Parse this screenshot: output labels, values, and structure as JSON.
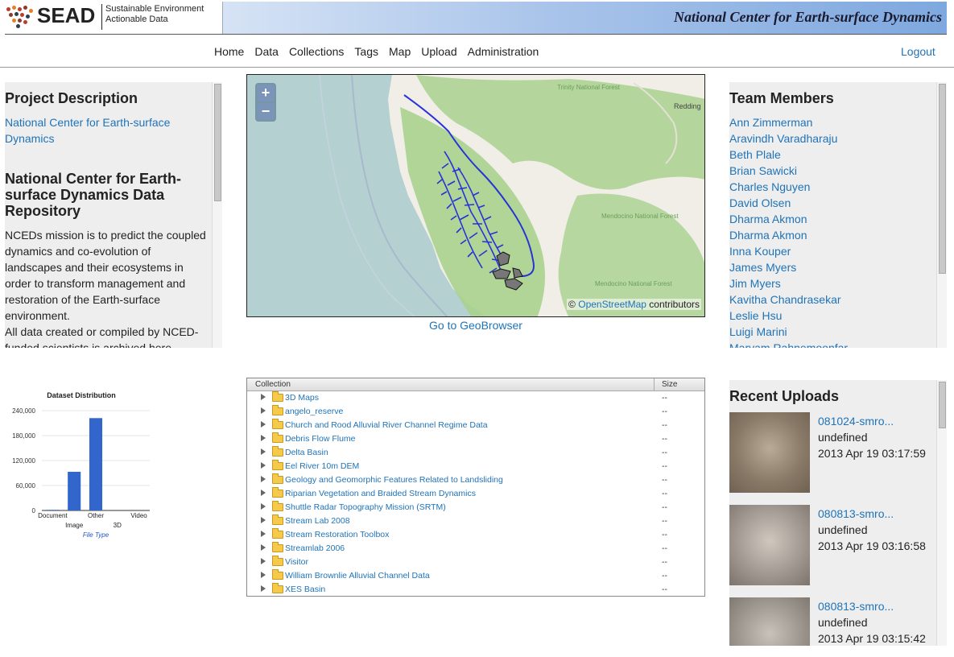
{
  "header": {
    "logo_word": "SEAD",
    "logo_tag_line1": "Sustainable Environment",
    "logo_tag_line2": "Actionable Data",
    "banner_title": "National Center for Earth-surface Dynamics"
  },
  "nav": {
    "items": [
      "Home",
      "Data",
      "Collections",
      "Tags",
      "Map",
      "Upload",
      "Administration"
    ],
    "logout": "Logout"
  },
  "project": {
    "heading": "Project Description",
    "link": "National Center for Earth-surface Dynamics",
    "repo_title": "National Center for Earth-surface Dynamics Data Repository",
    "mission": "NCEDs mission is to predict the coupled dynamics and co-evolution of landscapes and their ecosystems in order to transform management and restoration of the Earth-surface environment.",
    "archive": "All data created or compiled by NCED-funded scientists is archived here."
  },
  "map": {
    "zoom_in": "+",
    "zoom_out": "−",
    "attrib_prefix": "©",
    "attrib_link": "OpenStreetMap",
    "attrib_suffix": "contributors",
    "labels": [
      "Trinity National Forest",
      "Redding",
      "Mendocino National Forest",
      "Mendocino National Forest"
    ],
    "geobrowser_link": "Go to GeoBrowser"
  },
  "team": {
    "heading": "Team Members",
    "members": [
      "Ann Zimmerman",
      "Aravindh Varadharaju",
      "Beth Plale",
      "Brian Sawicki",
      "Charles Nguyen",
      "David Olsen",
      "Dharma Akmon",
      "Dharma Akmon",
      "Inna Kouper",
      "James Myers",
      "Jim Myers",
      "Kavitha Chandrasekar",
      "Leslie Hsu",
      "Luigi Marini",
      "Maryam Rahnemoonfar"
    ]
  },
  "chart_data": {
    "type": "bar",
    "title": "Dataset Distribution",
    "xlabel": "File Type",
    "ylabel": "",
    "categories": [
      "Document",
      "Image",
      "Other",
      "3D",
      "Video"
    ],
    "values": [
      1500,
      93000,
      222000,
      0,
      0
    ],
    "ylim": [
      0,
      240000
    ],
    "yticks": [
      "0",
      "60,000",
      "120,000",
      "180,000",
      "240,000"
    ],
    "color": "#3366cc"
  },
  "collections": {
    "col_collection": "Collection",
    "col_size": "Size",
    "rows": [
      {
        "name": "3D Maps",
        "size": "--"
      },
      {
        "name": "angelo_reserve",
        "size": "--"
      },
      {
        "name": "Church and Rood Alluvial River Channel Regime Data",
        "size": "--"
      },
      {
        "name": "Debris Flow Flume",
        "size": "--"
      },
      {
        "name": "Delta Basin",
        "size": "--"
      },
      {
        "name": "Eel River 10m DEM",
        "size": "--"
      },
      {
        "name": "Geology and Geomorphic Features Related to Landsliding",
        "size": "--"
      },
      {
        "name": "Riparian Vegetation and Braided Stream Dynamics",
        "size": "--"
      },
      {
        "name": "Shuttle Radar Topography Mission (SRTM)",
        "size": "--"
      },
      {
        "name": "Stream Lab 2008",
        "size": "--"
      },
      {
        "name": "Stream Restoration Toolbox",
        "size": "--"
      },
      {
        "name": "Streamlab 2006",
        "size": "--"
      },
      {
        "name": "Visitor",
        "size": "--"
      },
      {
        "name": "William Brownlie Alluvial Channel Data",
        "size": "--"
      },
      {
        "name": "XES Basin",
        "size": "--"
      }
    ]
  },
  "recent": {
    "heading": "Recent Uploads",
    "items": [
      {
        "name": "081024-smro...",
        "desc": "undefined",
        "date": "2013 Apr 19 03:17:59"
      },
      {
        "name": "080813-smro...",
        "desc": "undefined",
        "date": "2013 Apr 19 03:16:58"
      },
      {
        "name": "080813-smro...",
        "desc": "undefined",
        "date": "2013 Apr 19 03:15:42"
      }
    ]
  }
}
